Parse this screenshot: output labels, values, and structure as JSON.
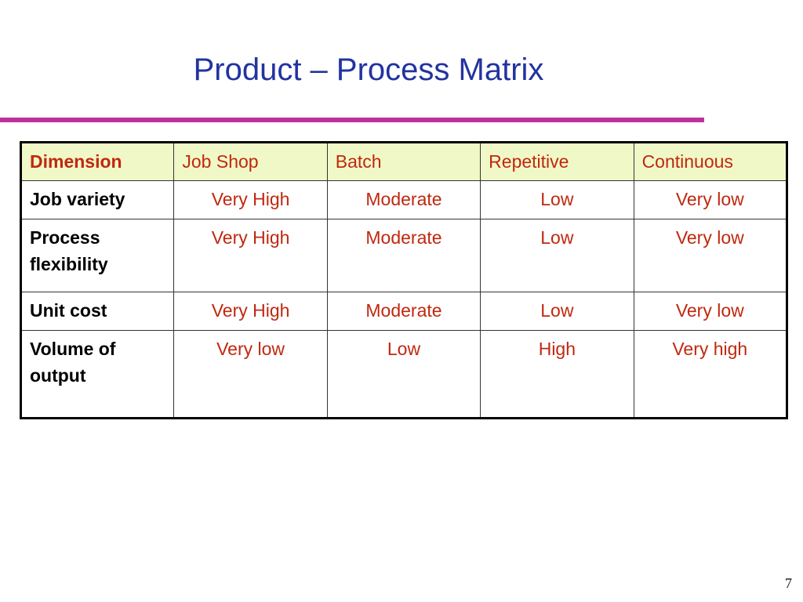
{
  "slide": {
    "title": "Product – Process Matrix",
    "page_number": "7",
    "colors": {
      "title": "#2233a0",
      "rule": "#c0309a",
      "header_bg": "#f1f8c8",
      "value_text": "#c0280f",
      "label_text": "#000000"
    }
  },
  "table": {
    "headers": [
      "Dimension",
      "Job Shop",
      "Batch",
      "Repetitive",
      "Continuous"
    ],
    "rows": [
      {
        "label": "Job variety",
        "values": [
          "Very High",
          "Moderate",
          "Low",
          "Very low"
        ]
      },
      {
        "label": "Process flexibility",
        "values": [
          "Very High",
          "Moderate",
          "Low",
          "Very low"
        ]
      },
      {
        "label": "Unit cost",
        "values": [
          "Very High",
          "Moderate",
          "Low",
          "Very low"
        ]
      },
      {
        "label": "Volume of output",
        "values": [
          "Very low",
          "Low",
          "High",
          "Very high"
        ]
      }
    ]
  }
}
